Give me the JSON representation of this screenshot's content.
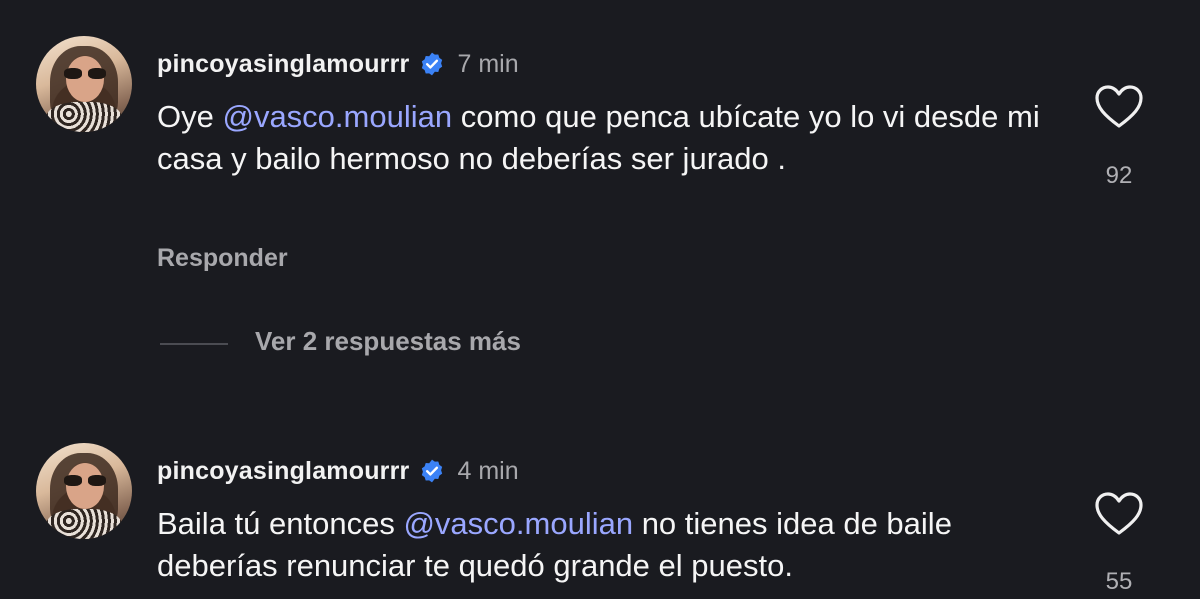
{
  "colors": {
    "background": "#1a1b20",
    "mention": "#9aa7ff",
    "verified_badge": "#3b82f6",
    "secondary_text": "#a8a8ac"
  },
  "comments": [
    {
      "username": "pincoyasinglamourrr",
      "verified_icon": "verified-badge-icon",
      "time": "7 min",
      "text_before": "Oye ",
      "mention": "@vasco.moulian",
      "text_after": " como que penca ubícate yo lo vi desde mi casa y bailo hermoso no deberías ser jurado .",
      "reply_label": "Responder",
      "likes": "92",
      "like_icon": "heart-icon"
    },
    {
      "username": "pincoyasinglamourrr",
      "verified_icon": "verified-badge-icon",
      "time": "4 min",
      "text_before": "Baila tú entonces ",
      "mention": "@vasco.moulian",
      "text_after": " no tienes idea de baile deberías renunciar te quedó grande el puesto.",
      "likes": "55",
      "like_icon": "heart-icon"
    }
  ],
  "more_replies": {
    "label": "Ver 2 respuestas más"
  }
}
